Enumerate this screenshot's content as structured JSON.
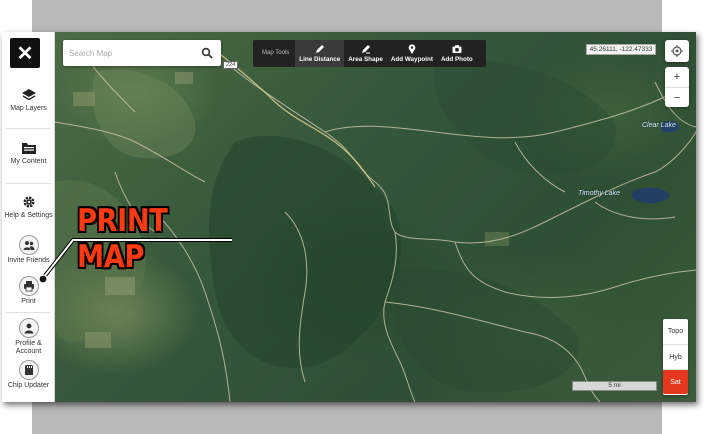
{
  "sidebar": {
    "close_icon": "close-x-icon",
    "items": [
      {
        "label": "Map Layers",
        "icon": "layers-icon"
      },
      {
        "label": "My Content",
        "icon": "folder-icon"
      },
      {
        "label": "Help & Settings",
        "icon": "gear-icon"
      },
      {
        "label": "Invite Friends",
        "icon": "people-icon"
      },
      {
        "label": "Print",
        "icon": "printer-icon"
      },
      {
        "label": "Profile & Account",
        "icon": "user-icon"
      },
      {
        "label": "Chip Updater",
        "icon": "chip-icon"
      }
    ]
  },
  "search": {
    "placeholder": "Search Map",
    "value": ""
  },
  "toolbar": {
    "label": "Map Tools",
    "tools": [
      {
        "label": "Line Distance",
        "icon": "pencil-icon"
      },
      {
        "label": "Area Shape",
        "icon": "area-shape-icon"
      },
      {
        "label": "Add Waypoint",
        "icon": "map-pin-icon"
      },
      {
        "label": "Add Photo",
        "icon": "camera-icon"
      }
    ]
  },
  "map": {
    "coordinates": "45.26111, -122.47333",
    "zoom_in": "+",
    "zoom_out": "−",
    "route_shield": "224",
    "lakes": [
      "Clear Lake",
      "Timothy Lake"
    ],
    "layers": [
      "Topo",
      "Hyb",
      "Sat"
    ],
    "selected_layer": "Sat",
    "scale": "5 mi"
  },
  "callout": {
    "text": "PRINT MAP"
  },
  "colors": {
    "accent": "#e4371b",
    "callout": "#ff3a10",
    "toolbar": "#222222"
  }
}
